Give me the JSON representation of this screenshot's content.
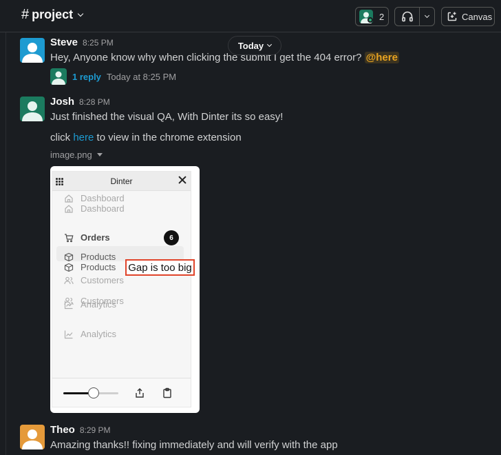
{
  "header": {
    "channel_hash": "#",
    "channel_name": "project",
    "members_count": "2",
    "canvas_label": "Canvas"
  },
  "date_divider": "Today",
  "messages": [
    {
      "name": "Steve",
      "time": "8:25 PM",
      "text_before": "Hey, Anyone know why when clicking the submit I get the 404 error?",
      "mention": "@here",
      "thread": {
        "reply_label": "1 reply",
        "reply_time": "Today at 8:25 PM"
      }
    },
    {
      "name": "Josh",
      "time": "8:28 PM",
      "line1": "Just finished the visual QA, With Dinter its so easy!",
      "line2_before": "click",
      "line2_link": "here",
      "line2_after": "to view in the chrome extension",
      "file_name": "image.png",
      "attachment": {
        "title": "Dinter",
        "nav": [
          "Dashboard",
          "Dashboard",
          "Orders",
          "Products",
          "Products",
          "Customers",
          "Customers",
          "Analytics",
          "Analytics"
        ],
        "orders_badge": "6",
        "annotation": "Gap is too big",
        "slider_level": 0.55
      }
    },
    {
      "name": "Theo",
      "time": "8:29 PM",
      "text": "Amazing thanks!! fixing immediately and will verify with the app"
    }
  ],
  "colors": {
    "background": "#1a1d21",
    "link": "#1d9bd1",
    "mention": "#e8a320",
    "annotation_border": "#e0442a"
  },
  "icons": [
    "headphones-icon",
    "chevron-down-icon",
    "canvas-icon",
    "home-icon",
    "cart-icon",
    "box-icon",
    "users-icon",
    "chart-icon",
    "share-icon",
    "clipboard-icon",
    "close-icon",
    "grip-icon"
  ]
}
